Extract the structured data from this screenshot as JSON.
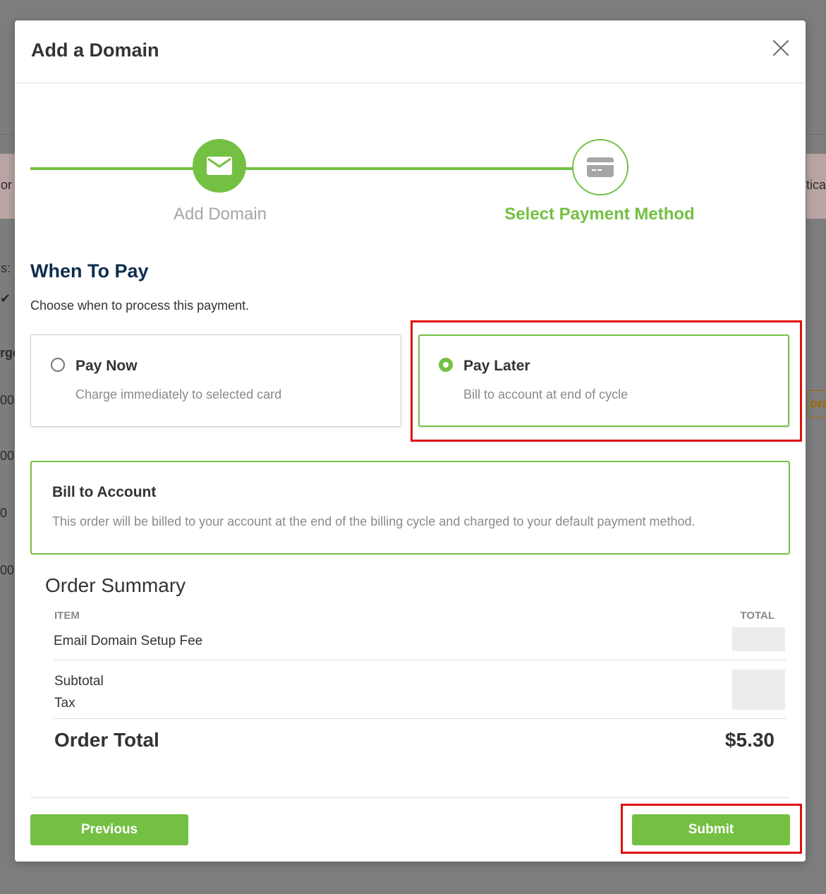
{
  "background": {
    "fragments": [
      "or",
      "s:",
      "✔",
      "rge",
      "00",
      "00",
      "0",
      "00",
      "tica",
      "ora"
    ]
  },
  "modal": {
    "title": "Add a Domain",
    "close_icon": "close-icon"
  },
  "stepper": {
    "steps": [
      {
        "label": "Add Domain",
        "icon": "envelope-icon",
        "state": "complete"
      },
      {
        "label": "Select Payment Method",
        "icon": "credit-card-icon",
        "state": "active"
      }
    ]
  },
  "when_to_pay": {
    "title": "When To Pay",
    "subtitle": "Choose when to process this payment.",
    "options": [
      {
        "title": "Pay Now",
        "description": "Charge immediately to selected card",
        "selected": false
      },
      {
        "title": "Pay Later",
        "description": "Bill to account at end of cycle",
        "selected": true
      }
    ]
  },
  "bill_to_account": {
    "title": "Bill to Account",
    "description": "This order will be billed to your account at the end of the billing cycle and charged to your default payment method."
  },
  "order_summary": {
    "title": "Order Summary",
    "columns": {
      "item": "ITEM",
      "total": "TOTAL"
    },
    "items": [
      {
        "name": "Email Domain Setup Fee"
      }
    ],
    "subtotal_label": "Subtotal",
    "tax_label": "Tax",
    "order_total_label": "Order Total",
    "order_total_value": "$5.30"
  },
  "footer": {
    "previous_label": "Previous",
    "submit_label": "Submit"
  },
  "colors": {
    "accent": "#74c043",
    "title_navy": "#0f2d4f",
    "highlight": "#e01010"
  }
}
